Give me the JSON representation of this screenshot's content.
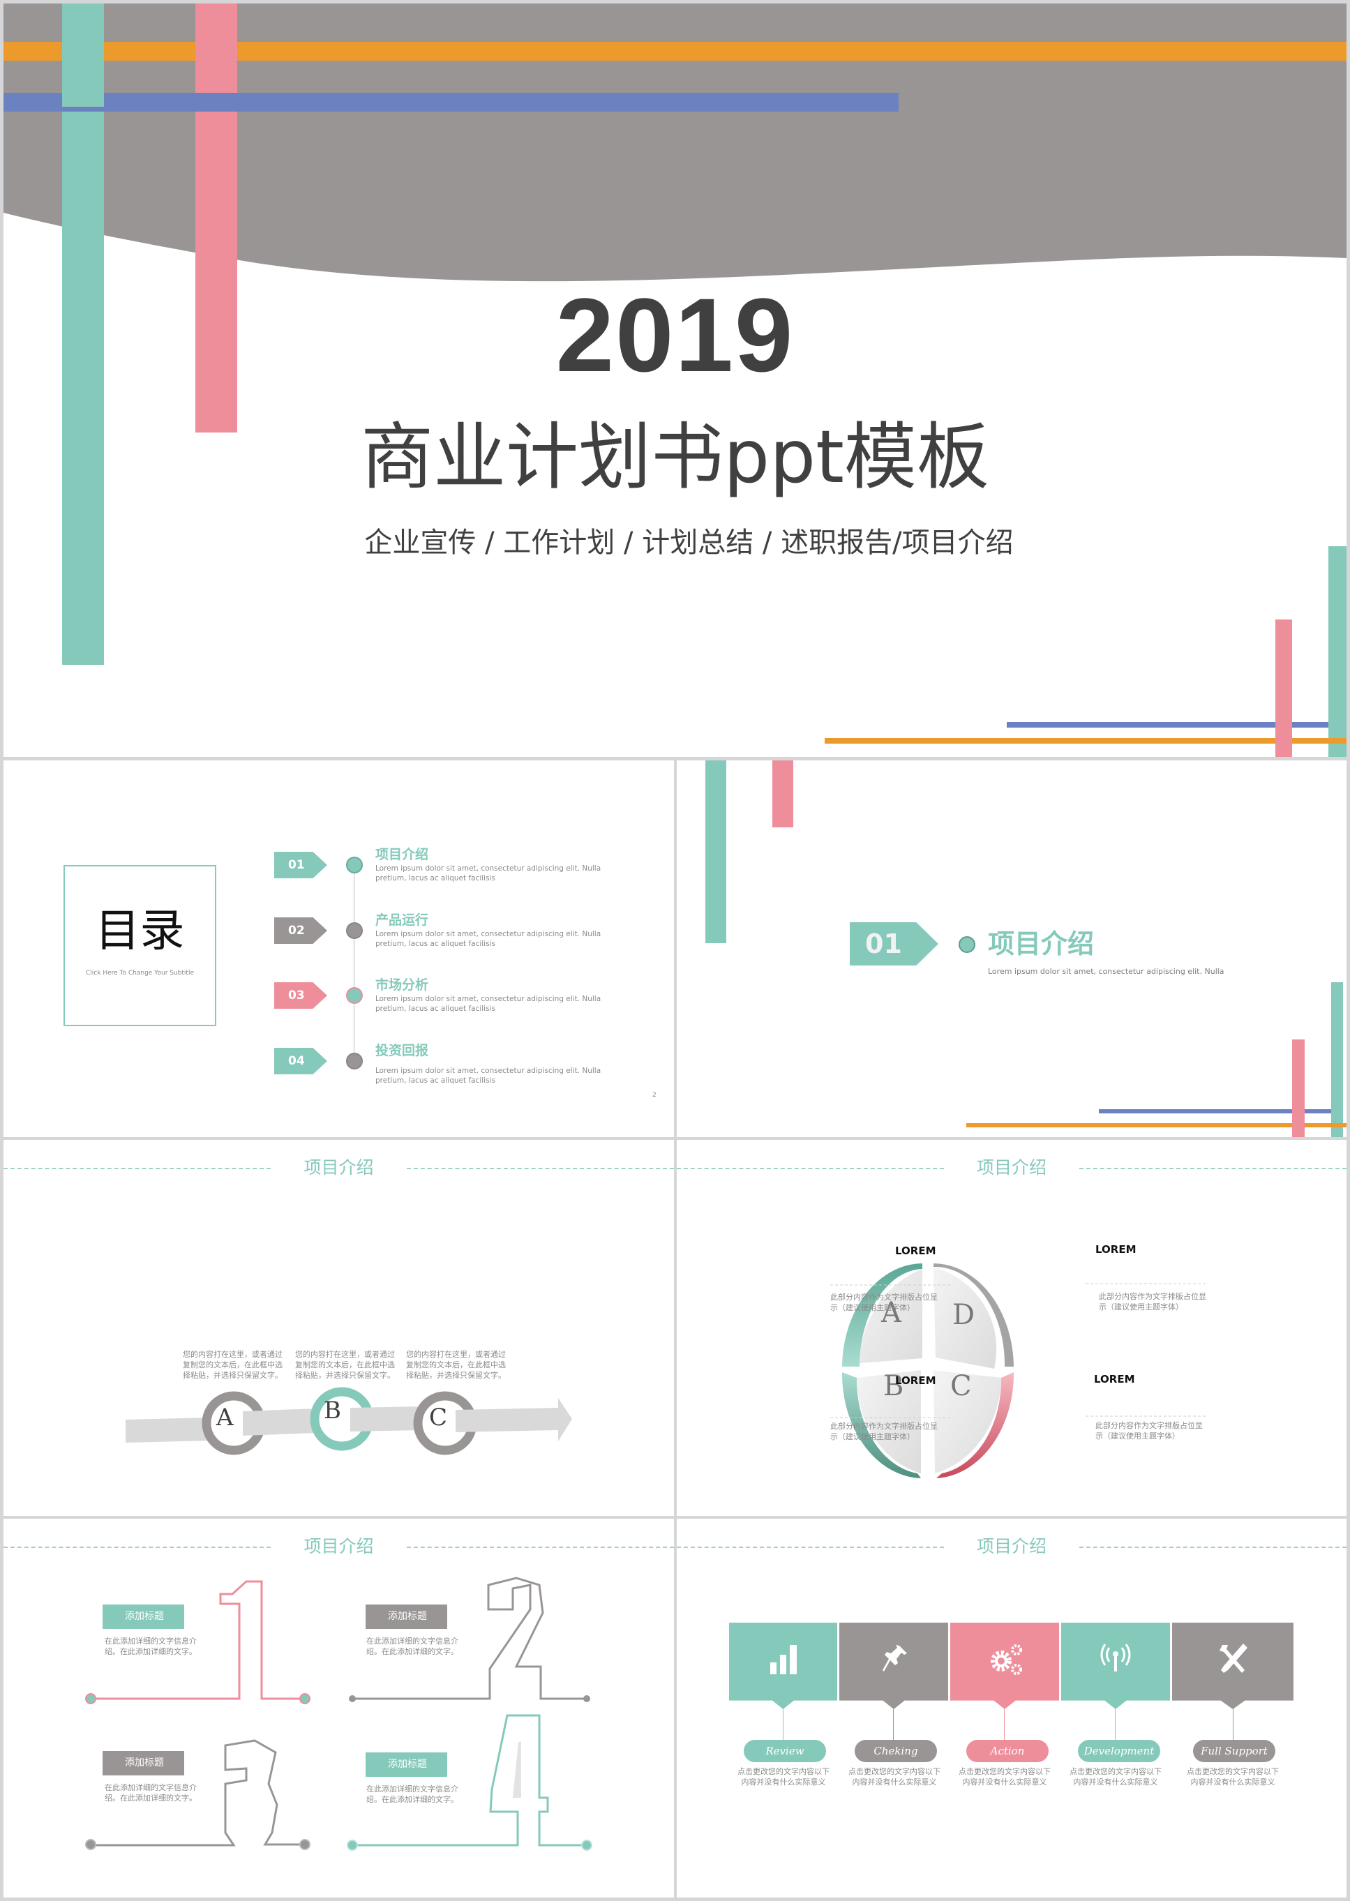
{
  "colors": {
    "teal": "#85c9bb",
    "pink": "#ef8e9b",
    "orange": "#ec9a2c",
    "blue": "#6c82c0",
    "gray": "#9a9595",
    "text_dark": "#404040"
  },
  "cover": {
    "year": "2019",
    "title": "商业计划书ppt模板",
    "subtitle": "企业宣传 / 工作计划 / 计划总结 / 述职报告/项目介绍"
  },
  "toc": {
    "heading": "目录",
    "subheading": "Click Here To Change Your Subtitle",
    "page_number": "2",
    "items": [
      {
        "num": "01",
        "title": "项目介绍",
        "desc": "Lorem ipsum dolor sit amet, consectetur adipiscing elit. Nulla pretium, lacus ac aliquet facilisis",
        "tag_color": "teal",
        "dot_color": "teal"
      },
      {
        "num": "02",
        "title": "产品运行",
        "desc": "Lorem ipsum dolor sit amet, consectetur adipiscing elit. Nulla pretium, lacus ac aliquet facilisis",
        "tag_color": "gray",
        "dot_color": "gray"
      },
      {
        "num": "03",
        "title": "市场分析",
        "desc": "Lorem ipsum dolor sit amet, consectetur adipiscing elit. Nulla pretium, lacus ac aliquet facilisis",
        "tag_color": "pink",
        "dot_color": "teal"
      },
      {
        "num": "04",
        "title": "投资回报",
        "desc": "Lorem ipsum dolor sit amet, consectetur adipiscing elit. Nulla pretium, lacus ac aliquet facilisis",
        "tag_color": "teal",
        "dot_color": "gray"
      }
    ]
  },
  "section": {
    "num": "01",
    "title": "项目介绍",
    "desc": "Lorem ipsum dolor sit amet, consectetur adipiscing elit. Nulla"
  },
  "process_slide": {
    "header": "项目介绍",
    "steps": [
      {
        "letter": "A",
        "ring": "gray",
        "text": "您的内容打在这里，或者通过复制您的文本后，在此框中选择粘贴，并选择只保留文字。"
      },
      {
        "letter": "B",
        "ring": "teal",
        "text": "您的内容打在这里，或者通过复制您的文本后，在此框中选择粘贴，并选择只保留文字。"
      },
      {
        "letter": "C",
        "ring": "gray",
        "text": "您的内容打在这里，或者通过复制您的文本后，在此框中选择粘贴，并选择只保留文字。"
      }
    ]
  },
  "quad_slide": {
    "header": "项目介绍",
    "quadrants": [
      {
        "letter": "A",
        "label": "LOREM",
        "text": "此部分内容作为文字排版占位显示（建议使用主题字体）"
      },
      {
        "letter": "D",
        "label": "LOREM",
        "text": "此部分内容作为文字排版占位显示（建议使用主题字体）"
      },
      {
        "letter": "B",
        "label": "LOREM",
        "text": "此部分内容作为文字排版占位显示（建议使用主题字体）"
      },
      {
        "letter": "C",
        "label": "LOREM",
        "text": "此部分内容作为文字排版占位显示（建议使用主题字体）"
      }
    ]
  },
  "numbers_slide": {
    "header": "项目介绍",
    "items": [
      {
        "num": "1",
        "tag": "添加标题",
        "text": "在此添加详细的文字信息介绍。在此添加详细的文字。",
        "color": "pink",
        "tag_color": "teal"
      },
      {
        "num": "2",
        "tag": "添加标题",
        "text": "在此添加详细的文字信息介绍。在此添加详细的文字。",
        "color": "gray",
        "tag_color": "gray"
      },
      {
        "num": "3",
        "tag": "添加标题",
        "text": "在此添加详细的文字信息介绍。在此添加详细的文字。",
        "color": "gray",
        "tag_color": "gray"
      },
      {
        "num": "4",
        "tag": "添加标题",
        "text": "在此添加详细的文字信息介绍。在此添加详细的文字。",
        "color": "teal",
        "tag_color": "teal"
      }
    ]
  },
  "features_slide": {
    "header": "项目介绍",
    "items": [
      {
        "label": "Review",
        "icon": "bar-chart-icon",
        "color": "teal",
        "text": "点击更改您的文字内容以下内容并没有什么实际意义"
      },
      {
        "label": "Cheking",
        "icon": "pushpin-icon",
        "color": "gray",
        "text": "点击更改您的文字内容以下内容并没有什么实际意义"
      },
      {
        "label": "Action",
        "icon": "gears-icon",
        "color": "pink",
        "text": "点击更改您的文字内容以下内容并没有什么实际意义"
      },
      {
        "label": "Development",
        "icon": "antenna-icon",
        "color": "teal",
        "text": "点击更改您的文字内容以下内容并没有什么实际意义"
      },
      {
        "label": "Full Support",
        "icon": "tools-icon",
        "color": "gray",
        "text": "点击更改您的文字内容以下内容并没有什么实际意义"
      }
    ]
  }
}
